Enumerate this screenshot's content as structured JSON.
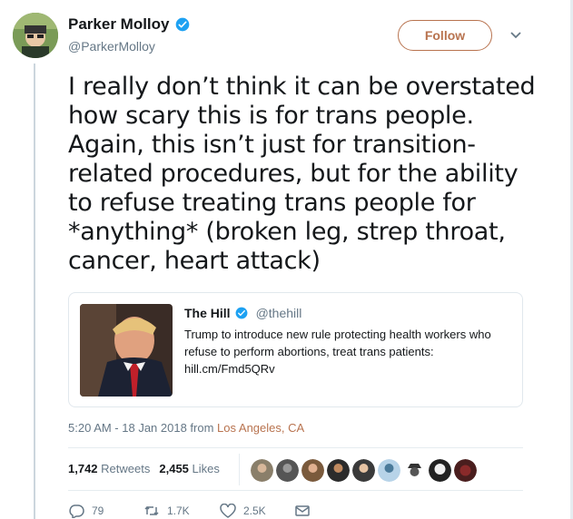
{
  "tweet": {
    "author_name": "Parker Molloy",
    "author_handle": "@ParkerMolloy",
    "follow_label": "Follow",
    "text": "I really don’t think it can be overstated how scary this is for trans people. Again, this isn’t just for transition-related procedures, but for the ability to refuse treating trans people for *anything* (broken leg, strep throat, cancer, heart attack)",
    "timestamp": "5:20 AM - 18 Jan 2018 from ",
    "location": "Los Angeles, CA"
  },
  "quote": {
    "name": "The Hill",
    "handle": "@thehill",
    "text": "Trump to introduce new rule protecting health workers who refuse to perform abortions, treat trans patients: hill.cm/Fmd5QRv"
  },
  "stats": {
    "retweets_count": "1,742",
    "retweets_label": "Retweets",
    "likes_count": "2,455",
    "likes_label": "Likes"
  },
  "actions": {
    "replies": "79",
    "retweets": "1.7K",
    "likes": "2.5K"
  },
  "colors": {
    "accent": "#b8734f",
    "verified": "#1da1f2",
    "muted": "#657786"
  },
  "icons": [
    "verified-badge-icon",
    "chevron-down-icon",
    "reply-icon",
    "retweet-icon",
    "like-icon",
    "message-icon"
  ]
}
